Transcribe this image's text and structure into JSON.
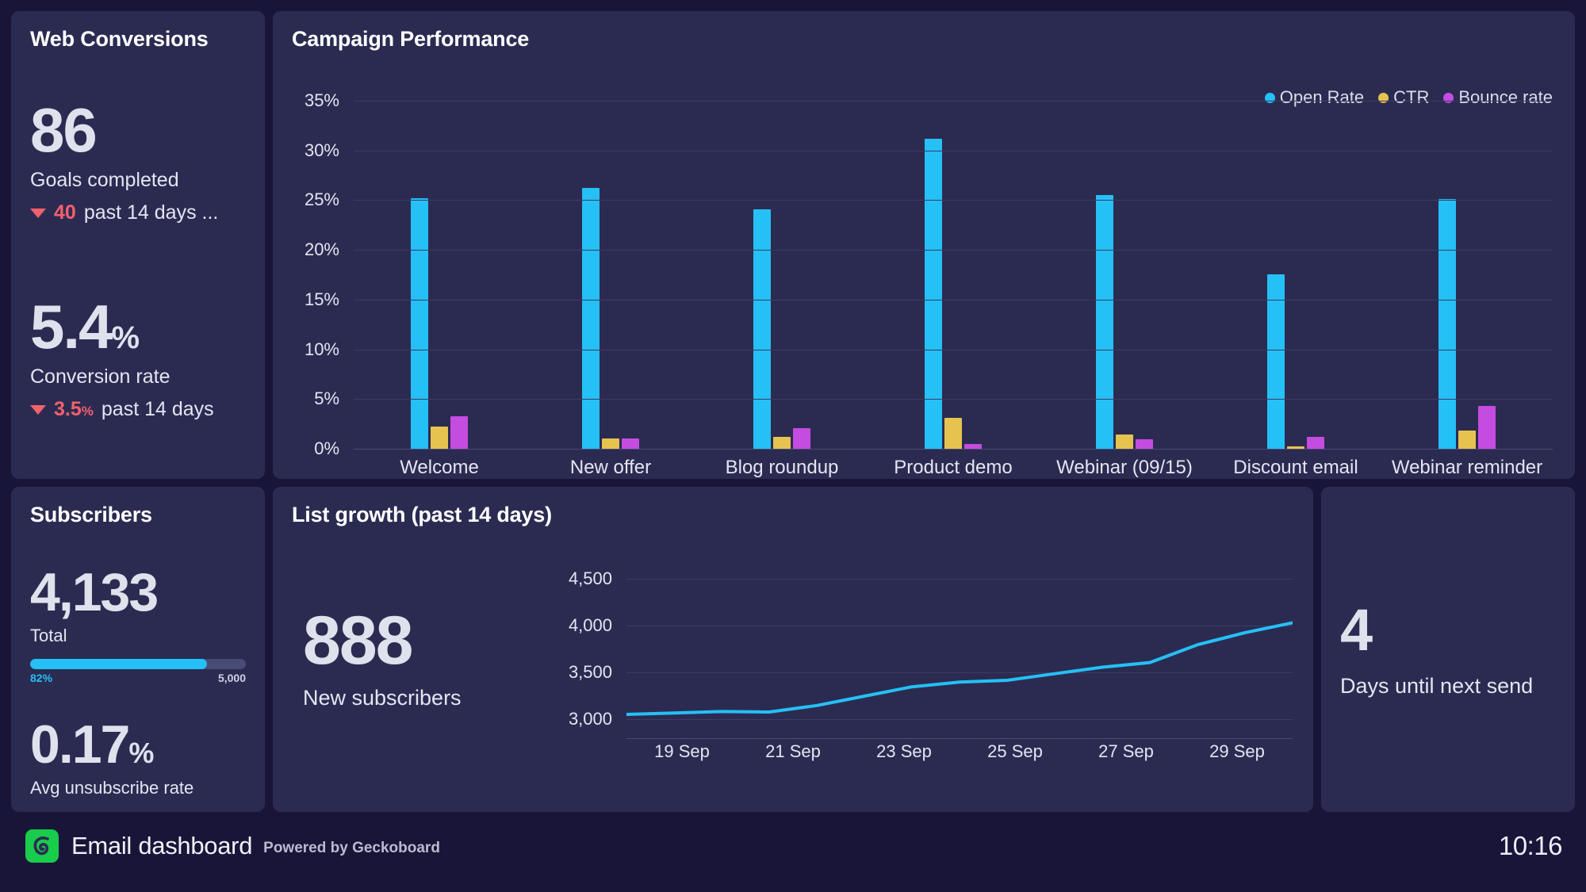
{
  "theme": {
    "page_bg": "#191538",
    "card_bg": "#2b2b52",
    "accent_cyan": "#25c0f5",
    "accent_yellow": "#e6c34f",
    "accent_magenta": "#c44ce0",
    "negative_red": "#f4616b",
    "logo_green": "#18cc4c"
  },
  "web_conversions": {
    "title": "Web Conversions",
    "goals": {
      "value": "86",
      "label": "Goals completed",
      "delta_direction": "down",
      "delta_value": "40",
      "delta_text": "past 14 days ..."
    },
    "conversion_rate": {
      "value": "5.4",
      "unit": "%",
      "label": "Conversion rate",
      "delta_direction": "down",
      "delta_value": "3.5",
      "delta_unit": "%",
      "delta_text": "past 14 days"
    }
  },
  "campaign_performance": {
    "title": "Campaign Performance"
  },
  "subscribers": {
    "title": "Subscribers",
    "total": {
      "value": "4,133",
      "label": "Total"
    },
    "progress": {
      "percent_label": "82%",
      "percent": 82,
      "target_label": "5,000"
    },
    "unsubscribe": {
      "value": "0.17",
      "unit": "%",
      "label": "Avg unsubscribe rate"
    }
  },
  "list_growth": {
    "title": "List growth (past 14 days)",
    "new_subscribers": {
      "value": "888",
      "label": "New subscribers"
    }
  },
  "next_send": {
    "value": "4",
    "label": "Days until next send"
  },
  "footer": {
    "logo_icon": "geckoboard-swirl-icon",
    "title": "Email dashboard",
    "powered_by": "Powered by Geckoboard",
    "clock": "10:16"
  },
  "chart_data": [
    {
      "id": "campaign_performance",
      "type": "bar",
      "title": "Campaign Performance",
      "xlabel": "",
      "ylabel": "",
      "ylim": [
        0,
        35
      ],
      "ytick_labels": [
        "35%",
        "30%",
        "25%",
        "20%",
        "15%",
        "10%",
        "5%",
        "0%"
      ],
      "yticks": [
        35,
        30,
        25,
        20,
        15,
        10,
        5,
        0
      ],
      "grid": true,
      "legend_position": "top-right",
      "categories": [
        "Welcome",
        "New offer",
        "Blog roundup",
        "Product demo",
        "Webinar (09/15)",
        "Discount email",
        "Webinar reminder"
      ],
      "series": [
        {
          "name": "Open Rate",
          "color": "#25c0f5",
          "values": [
            24.5,
            25.5,
            23.4,
            30.3,
            24.8,
            17.0,
            24.4
          ]
        },
        {
          "name": "CTR",
          "color": "#e6c34f",
          "values": [
            2.2,
            1.0,
            1.2,
            3.0,
            1.4,
            0.2,
            1.8
          ]
        },
        {
          "name": "Bounce rate",
          "color": "#c44ce0",
          "values": [
            3.2,
            1.0,
            2.0,
            0.5,
            0.9,
            1.2,
            4.2
          ]
        }
      ]
    },
    {
      "id": "list_growth",
      "type": "line",
      "title": "List growth (past 14 days)",
      "xlabel": "",
      "ylabel": "",
      "ylim": [
        2800,
        4600
      ],
      "ytick_labels": [
        "4,500",
        "4,000",
        "3,500",
        "3,000"
      ],
      "yticks": [
        4500,
        4000,
        3500,
        3000
      ],
      "grid": true,
      "line_color": "#25c0f5",
      "xtick_labels": [
        "19 Sep",
        "21 Sep",
        "23 Sep",
        "25 Sep",
        "27 Sep",
        "29 Sep"
      ],
      "x": [
        "17 Sep",
        "18 Sep",
        "19 Sep",
        "20 Sep",
        "21 Sep",
        "22 Sep",
        "23 Sep",
        "24 Sep",
        "25 Sep",
        "26 Sep",
        "27 Sep",
        "28 Sep",
        "29 Sep",
        "30 Sep"
      ],
      "values": [
        3055,
        3070,
        3085,
        3080,
        3150,
        3250,
        3350,
        3400,
        3420,
        3490,
        3560,
        3610,
        3800,
        3930,
        4035
      ]
    }
  ]
}
